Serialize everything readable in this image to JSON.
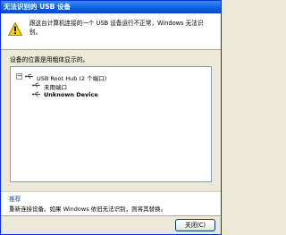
{
  "window": {
    "title": "无法识别的 USB 设备"
  },
  "message": {
    "icon": "warning-icon",
    "text": "跟这台计算机连接的一个 USB 设备运行不正常，Windows 无法识别。"
  },
  "location_label": "设备的位置是用粗体显示的。",
  "tree": {
    "root_label": "USB Root Hub (2 个端口)",
    "expander": "−",
    "children": [
      {
        "label": "未用端口",
        "bold": false
      },
      {
        "label": "Unknown Device",
        "bold": true
      }
    ],
    "icon": "usb-icon"
  },
  "tip": {
    "title": "推荐",
    "text": "重新连接设备。如果 Windows 依旧无法识别，则将其替换。"
  },
  "buttons": {
    "close_label": "关闭(C)"
  },
  "colors": {
    "title_bar": "#0a5fe0",
    "panel": "#ece9d8",
    "tip_title": "#1b4db3"
  }
}
